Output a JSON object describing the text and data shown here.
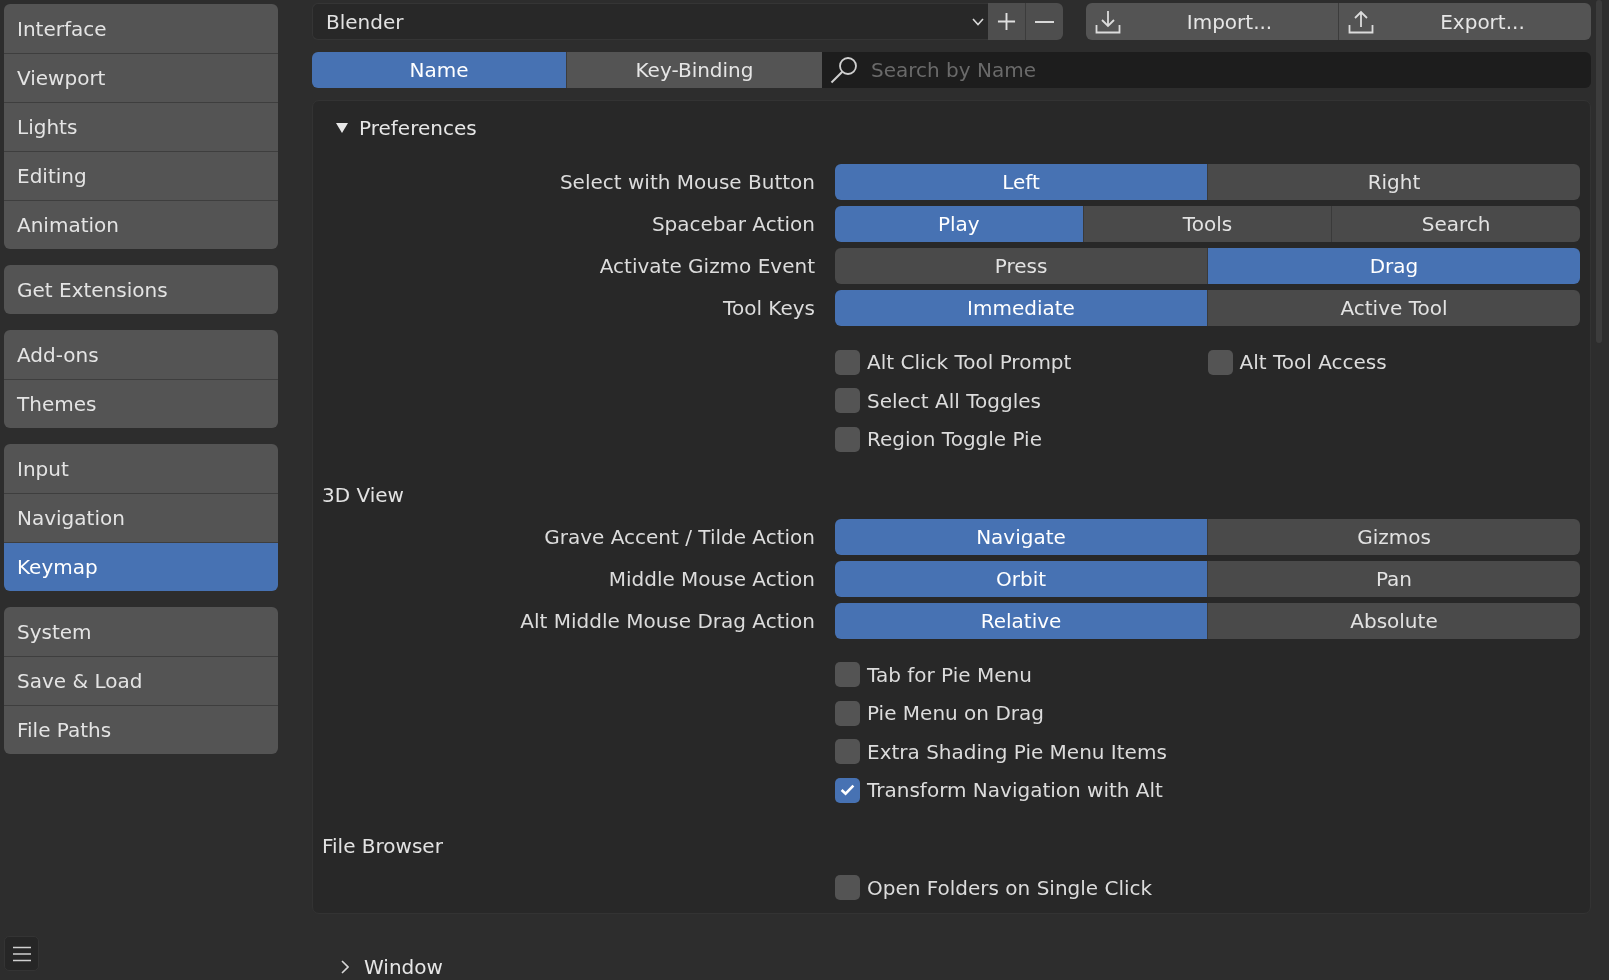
{
  "sidebar": {
    "groups": [
      {
        "items": [
          {
            "label": "Interface",
            "selected": false
          },
          {
            "label": "Viewport",
            "selected": false
          },
          {
            "label": "Lights",
            "selected": false
          },
          {
            "label": "Editing",
            "selected": false
          },
          {
            "label": "Animation",
            "selected": false
          }
        ]
      },
      {
        "items": [
          {
            "label": "Get Extensions",
            "selected": false
          }
        ]
      },
      {
        "items": [
          {
            "label": "Add-ons",
            "selected": false
          },
          {
            "label": "Themes",
            "selected": false
          }
        ]
      },
      {
        "items": [
          {
            "label": "Input",
            "selected": false
          },
          {
            "label": "Navigation",
            "selected": false
          },
          {
            "label": "Keymap",
            "selected": true
          }
        ]
      },
      {
        "items": [
          {
            "label": "System",
            "selected": false
          },
          {
            "label": "Save & Load",
            "selected": false
          },
          {
            "label": "File Paths",
            "selected": false
          }
        ]
      }
    ]
  },
  "toolbar": {
    "preset": {
      "value": "Blender"
    },
    "import_label": "Import...",
    "export_label": "Export..."
  },
  "filter": {
    "tabs": [
      {
        "label": "Name",
        "selected": true
      },
      {
        "label": "Key-Binding",
        "selected": false
      }
    ],
    "search": {
      "placeholder": "Search by Name"
    }
  },
  "panels": [
    {
      "title": "Preferences",
      "expanded": true,
      "sections": [
        {
          "rows": [
            {
              "kind": "enum",
              "label": "Select with Mouse Button",
              "options": [
                {
                  "label": "Left",
                  "selected": true
                },
                {
                  "label": "Right",
                  "selected": false
                }
              ]
            },
            {
              "kind": "enum",
              "label": "Spacebar Action",
              "options": [
                {
                  "label": "Play",
                  "selected": true
                },
                {
                  "label": "Tools",
                  "selected": false
                },
                {
                  "label": "Search",
                  "selected": false
                }
              ]
            },
            {
              "kind": "enum",
              "label": "Activate Gizmo Event",
              "options": [
                {
                  "label": "Press",
                  "selected": false
                },
                {
                  "label": "Drag",
                  "selected": true
                }
              ]
            },
            {
              "kind": "enum",
              "label": "Tool Keys",
              "options": [
                {
                  "label": "Immediate",
                  "selected": true
                },
                {
                  "label": "Active Tool",
                  "selected": false
                }
              ]
            },
            {
              "kind": "checks",
              "items": [
                {
                  "label": "Alt Click Tool Prompt",
                  "checked": false
                },
                {
                  "label": "Alt Tool Access",
                  "checked": false
                }
              ]
            },
            {
              "kind": "checks",
              "items": [
                {
                  "label": "Select All Toggles",
                  "checked": false
                }
              ]
            },
            {
              "kind": "checks",
              "items": [
                {
                  "label": "Region Toggle Pie",
                  "checked": false
                }
              ]
            }
          ]
        },
        {
          "heading": "3D View",
          "rows": [
            {
              "kind": "enum",
              "label": "Grave Accent / Tilde Action",
              "options": [
                {
                  "label": "Navigate",
                  "selected": true
                },
                {
                  "label": "Gizmos",
                  "selected": false
                }
              ]
            },
            {
              "kind": "enum",
              "label": "Middle Mouse Action",
              "options": [
                {
                  "label": "Orbit",
                  "selected": true
                },
                {
                  "label": "Pan",
                  "selected": false
                }
              ]
            },
            {
              "kind": "enum",
              "label": "Alt Middle Mouse Drag Action",
              "options": [
                {
                  "label": "Relative",
                  "selected": true
                },
                {
                  "label": "Absolute",
                  "selected": false
                }
              ]
            },
            {
              "kind": "checks",
              "items": [
                {
                  "label": "Tab for Pie Menu",
                  "checked": false
                }
              ]
            },
            {
              "kind": "checks",
              "items": [
                {
                  "label": "Pie Menu on Drag",
                  "checked": false
                }
              ]
            },
            {
              "kind": "checks",
              "items": [
                {
                  "label": "Extra Shading Pie Menu Items",
                  "checked": false
                }
              ]
            },
            {
              "kind": "checks",
              "items": [
                {
                  "label": "Transform Navigation with Alt",
                  "checked": true
                }
              ]
            }
          ]
        },
        {
          "heading": "File Browser",
          "rows": [
            {
              "kind": "checks",
              "items": [
                {
                  "label": "Open Folders on Single Click",
                  "checked": false
                }
              ]
            }
          ]
        }
      ]
    },
    {
      "title": "Window",
      "expanded": false
    }
  ]
}
